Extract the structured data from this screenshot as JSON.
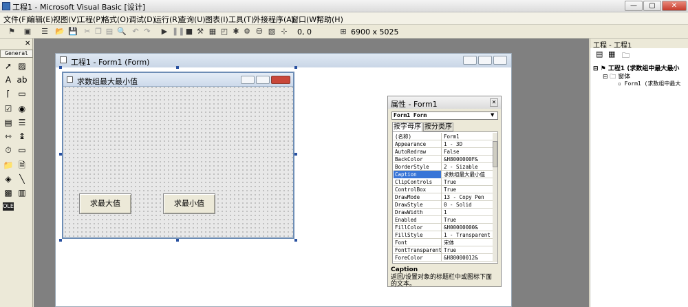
{
  "window": {
    "title": "工程1 - Microsoft Visual Basic [设计]",
    "min": "—",
    "max": "▢",
    "close": "✕"
  },
  "menu": [
    "文件(F)",
    "编辑(E)",
    "视图(V)",
    "工程(P)",
    "格式(O)",
    "调试(D)",
    "运行(R)",
    "查询(U)",
    "图表(I)",
    "工具(T)",
    "外接程序(A)",
    "窗口(W)",
    "帮助(H)"
  ],
  "toolbar": {
    "position": "0, 0",
    "size": "6900 x 5025"
  },
  "toolbox": {
    "header": "General"
  },
  "form_window": {
    "title": "工程1 - Form1 (Form)"
  },
  "designer": {
    "caption": "求数组最大最小值",
    "btn_max": "求最大值",
    "btn_min": "求最小值"
  },
  "properties": {
    "title": "属性 - Form1",
    "object": "Form1 Form",
    "tab_alpha": "按字母序",
    "tab_cat": "按分类序",
    "rows": [
      {
        "n": "(名称)",
        "v": "Form1"
      },
      {
        "n": "Appearance",
        "v": "1 - 3D"
      },
      {
        "n": "AutoRedraw",
        "v": "False"
      },
      {
        "n": "BackColor",
        "v": "&H8000000F&"
      },
      {
        "n": "BorderStyle",
        "v": "2 - Sizable"
      },
      {
        "n": "Caption",
        "v": "求数组最大最小值"
      },
      {
        "n": "ClipControls",
        "v": "True"
      },
      {
        "n": "ControlBox",
        "v": "True"
      },
      {
        "n": "DrawMode",
        "v": "13 - Copy Pen"
      },
      {
        "n": "DrawStyle",
        "v": "0 - Solid"
      },
      {
        "n": "DrawWidth",
        "v": "1"
      },
      {
        "n": "Enabled",
        "v": "True"
      },
      {
        "n": "FillColor",
        "v": "&H00000000&"
      },
      {
        "n": "FillStyle",
        "v": "1 - Transparent"
      },
      {
        "n": "Font",
        "v": "宋体"
      },
      {
        "n": "FontTransparent",
        "v": "True"
      },
      {
        "n": "ForeColor",
        "v": "&H80000012&"
      }
    ],
    "desc_title": "Caption",
    "desc": "返回/设置对象的标题栏中或图标下面的文本。"
  },
  "project": {
    "title": "工程 - 工程1",
    "root": "工程1 (求数组中最大最小",
    "folder": "窗体",
    "item": "Form1 (求数组中最大"
  }
}
